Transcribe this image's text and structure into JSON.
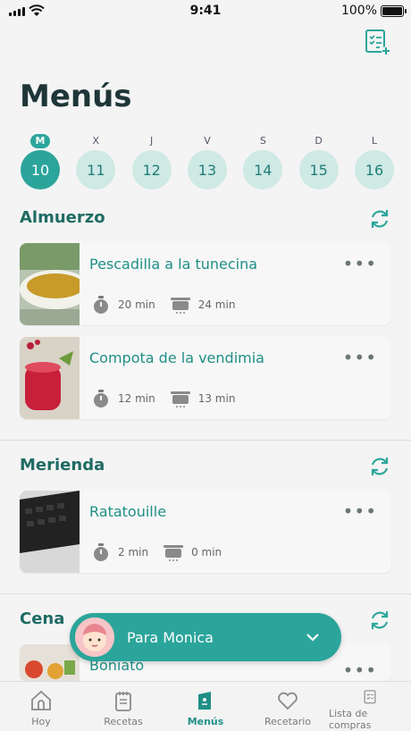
{
  "status": {
    "time": "9:41",
    "battery": "100%"
  },
  "header": {
    "title": "Menús"
  },
  "days": [
    {
      "weekday": "M",
      "num": "10",
      "active": true
    },
    {
      "weekday": "X",
      "num": "11",
      "active": false
    },
    {
      "weekday": "J",
      "num": "12",
      "active": false
    },
    {
      "weekday": "V",
      "num": "13",
      "active": false
    },
    {
      "weekday": "S",
      "num": "14",
      "active": false
    },
    {
      "weekday": "D",
      "num": "15",
      "active": false
    },
    {
      "weekday": "L",
      "num": "16",
      "active": false
    }
  ],
  "sections": {
    "lunch": {
      "title": "Almuerzo",
      "recipes": [
        {
          "name": "Pescadilla a la tunecina",
          "prep": "20 min",
          "cook": "24 min"
        },
        {
          "name": "Compota de la vendimia",
          "prep": "12 min",
          "cook": "13 min"
        }
      ]
    },
    "snack": {
      "title": "Merienda",
      "recipes": [
        {
          "name": "Ratatouille",
          "prep": "2 min",
          "cook": "0 min"
        }
      ]
    },
    "dinner": {
      "title": "Cena",
      "recipes": [
        {
          "name": "Boniato"
        }
      ]
    }
  },
  "profile_selector": {
    "label": "Para Monica"
  },
  "tabs": [
    {
      "label": "Hoy",
      "icon": "home-icon"
    },
    {
      "label": "Recetas",
      "icon": "recipes-icon"
    },
    {
      "label": "Menús",
      "icon": "menu-icon",
      "active": true
    },
    {
      "label": "Recetario",
      "icon": "heart-icon"
    },
    {
      "label": "Lista de compras",
      "icon": "list-icon"
    }
  ],
  "colors": {
    "accent": "#2ba59b",
    "accent_light": "#cfe9e4",
    "title": "#1f3638"
  }
}
